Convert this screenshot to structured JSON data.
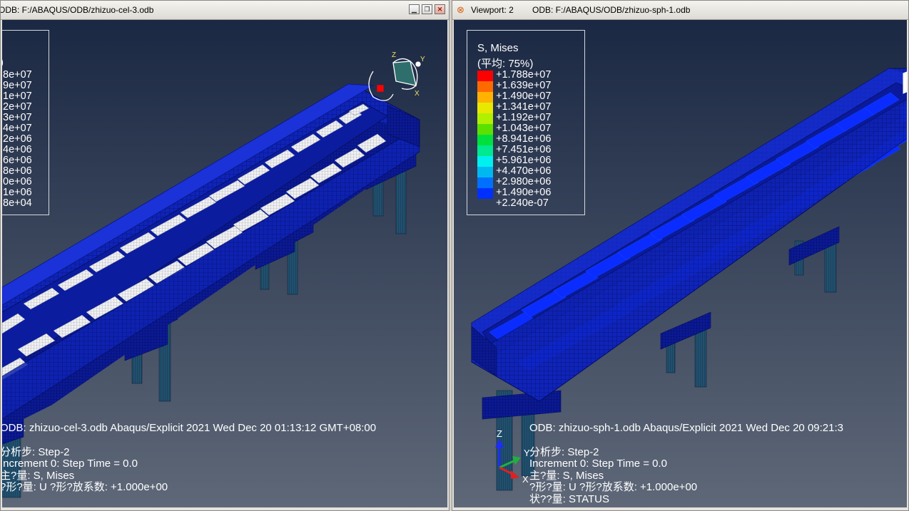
{
  "viewport1": {
    "odb_title": "ODB: F:/ABAQUS/ODB/zhizuo-cel-3.odb",
    "legend_title": "",
    "legend_sub": ")",
    "legend_values": [
      "8e+07",
      "9e+07",
      "1e+07",
      "2e+07",
      "3e+07",
      "4e+07",
      "2e+06",
      "4e+06",
      "6e+06",
      "8e+06",
      "0e+06",
      "1e+06",
      "8e+04"
    ],
    "info_lines": [
      "ODB: zhizuo-cel-3.odb    Abaqus/Explicit 2021    Wed Dec 20 01:13:12 GMT+08:00",
      "分析步: Step-2",
      "Increment        0: Step Time = 0.0",
      "主?量: S, Mises",
      "?形?量: U   ?形?放系数: +1.000e+00"
    ]
  },
  "viewport2": {
    "window_label": "Viewport: 2",
    "odb_title": "ODB: F:/ABAQUS/ODB/zhizuo-sph-1.odb",
    "legend_title": "S, Mises",
    "legend_sub": "(平均: 75%)",
    "legend_values": [
      "+1.788e+07",
      "+1.639e+07",
      "+1.490e+07",
      "+1.341e+07",
      "+1.192e+07",
      "+1.043e+07",
      "+8.941e+06",
      "+7.451e+06",
      "+5.961e+06",
      "+4.470e+06",
      "+2.980e+06",
      "+1.490e+06",
      "+2.240e-07"
    ],
    "info_lines": [
      "ODB: zhizuo-sph-1.odb    Abaqus/Explicit 2021    Wed Dec 20 09:21:3",
      "分析步: Step-2",
      "Increment        0: Step Time = 0.0",
      "主?量: S, Mises",
      "?形?量: U   ?形?放系数: +1.000e+00",
      "状??量: STATUS"
    ],
    "triad_labels": {
      "z": "Z",
      "y": "Y",
      "x": "X"
    }
  },
  "legend_colors": [
    "#ff0000",
    "#ff6a00",
    "#ffb300",
    "#e8e800",
    "#b0f000",
    "#5ce000",
    "#00e03c",
    "#00e890",
    "#00f0f0",
    "#00b8f0",
    "#0070ff",
    "#0030ff",
    "#0000e0"
  ],
  "window_controls": [
    "minimize",
    "restore",
    "close"
  ],
  "triad1_labels": {
    "z": "Z",
    "y": "Y",
    "x": "X"
  },
  "colors": {
    "background_top": "#1c2a44",
    "background_bottom": "#5d6676",
    "mesh": "#0d1fb0"
  }
}
